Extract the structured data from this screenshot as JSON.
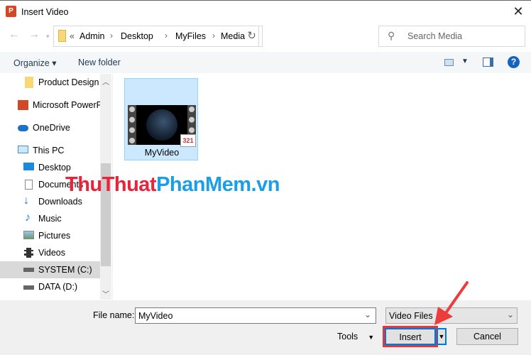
{
  "window": {
    "title": "Insert Video",
    "close": "✕"
  },
  "address": {
    "overflow": "«",
    "segments": [
      "Admin",
      "Desktop",
      "MyFiles",
      "Media"
    ]
  },
  "search": {
    "placeholder": "Search Media"
  },
  "toolbar": {
    "organize": "Organize",
    "new_folder": "New folder",
    "help": "?"
  },
  "sidebar": {
    "items": [
      {
        "label": "Product Design",
        "icon": "folder-icon"
      },
      {
        "label": "Microsoft PowerP",
        "icon": "powerpoint-icon"
      },
      {
        "label": "OneDrive",
        "icon": "cloud-icon"
      },
      {
        "label": "This PC",
        "icon": "computer-icon"
      },
      {
        "label": "Desktop",
        "icon": "desktop-icon"
      },
      {
        "label": "Documents",
        "icon": "document-icon"
      },
      {
        "label": "Downloads",
        "icon": "download-icon"
      },
      {
        "label": "Music",
        "icon": "music-icon"
      },
      {
        "label": "Pictures",
        "icon": "pictures-icon"
      },
      {
        "label": "Videos",
        "icon": "videos-icon"
      },
      {
        "label": "SYSTEM (C:)",
        "icon": "drive-icon",
        "selected": true
      },
      {
        "label": "DATA (D:)",
        "icon": "drive-icon"
      }
    ]
  },
  "files": [
    {
      "name": "MyVideo",
      "badge": "321"
    }
  ],
  "watermark": {
    "part1": "ThuThuat",
    "part2": "PhanMem.vn"
  },
  "footer": {
    "file_name_label": "File name:",
    "file_name_value": "MyVideo",
    "file_type": "Video Files",
    "tools": "Tools",
    "insert": "Insert",
    "cancel": "Cancel"
  },
  "colors": {
    "accent": "#0078d7",
    "highlight": "#e8333c",
    "selection": "#cce8ff"
  }
}
